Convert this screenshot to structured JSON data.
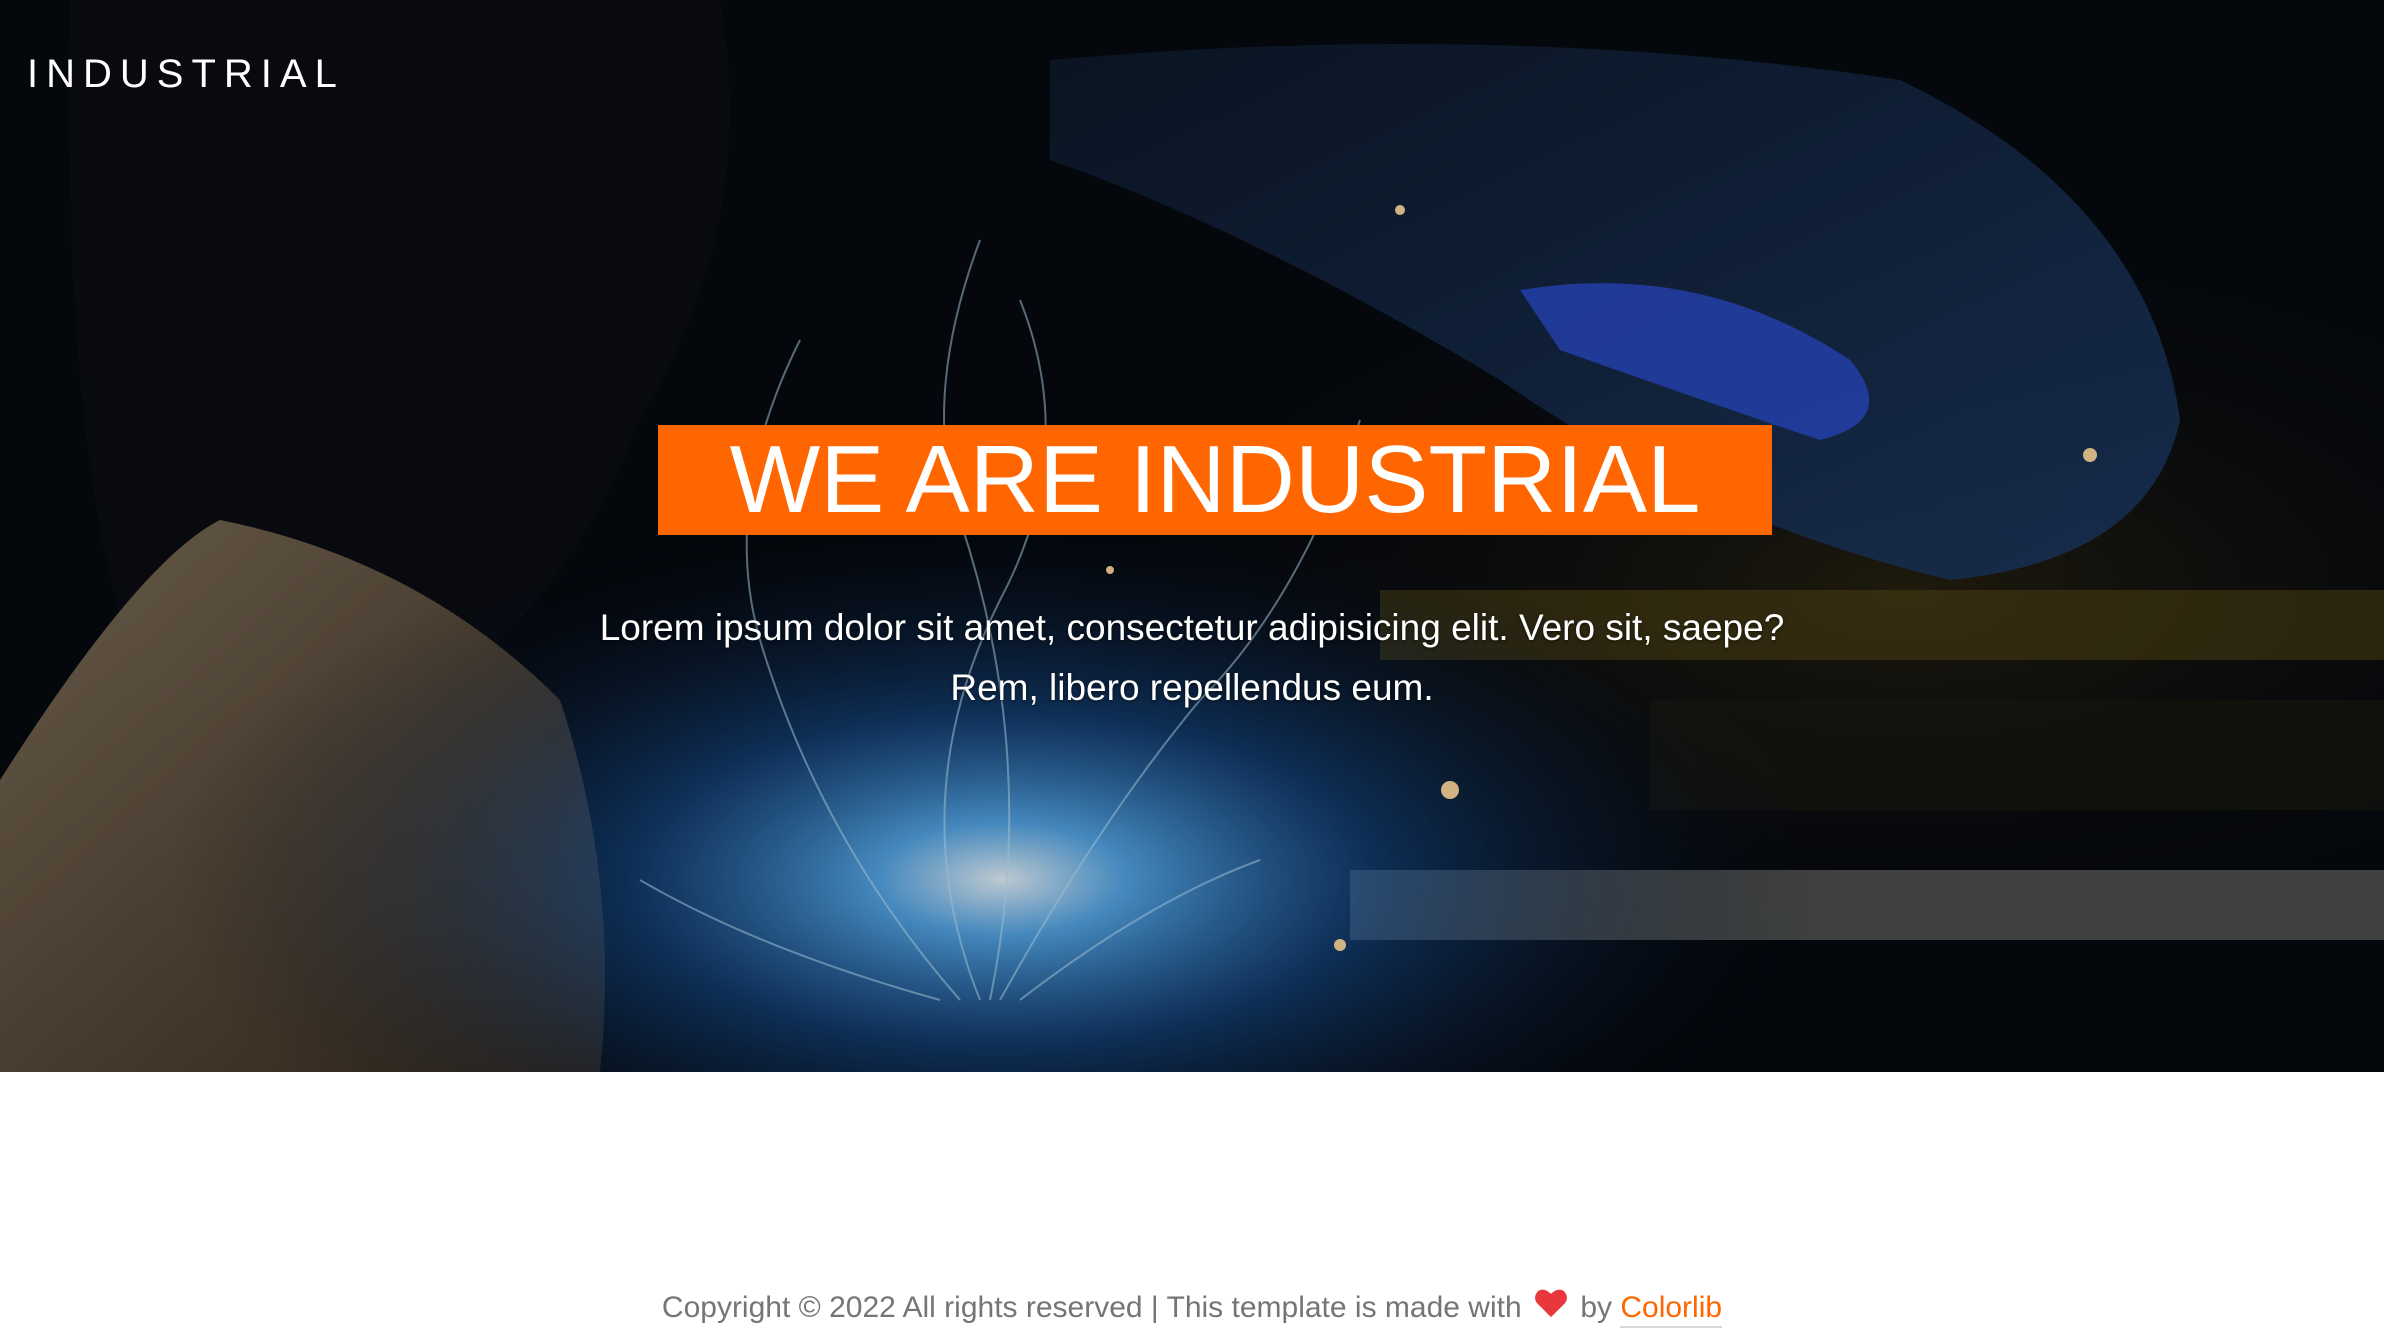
{
  "header": {
    "logo": "INDUSTRIAL"
  },
  "hero": {
    "headline": "WE ARE INDUSTRIAL",
    "lead": "Lorem ipsum dolor sit amet, consectetur adipisicing elit. Vero sit, saepe? Rem, libero repellendus eum.",
    "background_icon": "welding-photo",
    "accent_color": "#ff6600"
  },
  "footer": {
    "copyright_prefix": "Copyright © 2022 All rights reserved | This template is made with",
    "heart_icon": "heart-icon",
    "by_text": "by",
    "link_text": "Colorlib",
    "link_color": "#ff6600"
  }
}
